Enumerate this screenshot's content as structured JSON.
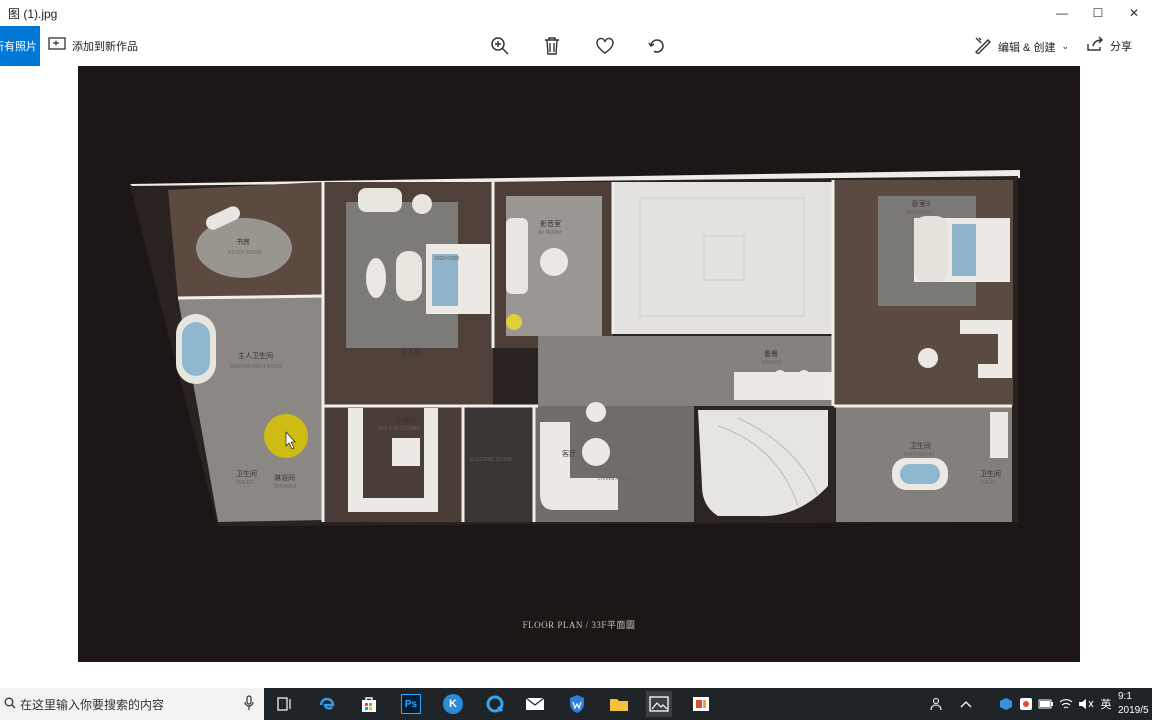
{
  "window": {
    "title": "图 (1).jpg",
    "controls": [
      "—",
      "☐",
      "✕"
    ]
  },
  "toolbar": {
    "all_photos_label": "所有照片",
    "add_to_creation_label": "添加到新作品",
    "zoom_icon": "zoom-in-icon",
    "delete_icon": "trash-icon",
    "favorite_icon": "heart-icon",
    "rotate_icon": "rotate-icon",
    "edit_create_label": "编辑 & 创建",
    "share_label": "分享"
  },
  "image": {
    "caption": "FLOOR PLAN / 33F平面圖",
    "rooms": {
      "study": "书房",
      "study_en": "STUDY ROOM",
      "master_bath": "主人卫生间",
      "master_bath_en": "MASTER BATH ROOM",
      "master_bed": "主人房",
      "av_room": "影音室",
      "av_room_en": "AV ROOM",
      "bedroom3": "卧室3",
      "bedroom3_en": "BEDROOM",
      "bed_size": "1800×2000",
      "pantry": "备餐",
      "pantry_en": "PANTRY",
      "bathroom": "卫生间",
      "bathroom_en": "BATH ROOM",
      "living": "客厅",
      "living_en": "LIVING AREA",
      "electric": "机电房",
      "electric_en": "ELECTRIC ROOM",
      "toilet": "卫生间",
      "toilet_en": "TOILET",
      "shower": "淋浴间",
      "shower_en": "SHOWER",
      "closet": "衣帽间",
      "closet_en": "WALK-IN CLOSET",
      "toilet2": "卫生间",
      "toilet2_en": "TOILET"
    }
  },
  "taskbar": {
    "search_placeholder": "在这里输入你要搜索的内容",
    "apps": [
      "task-view-icon",
      "edge-icon",
      "store-icon",
      "photoshop-icon",
      "k-app-icon",
      "q-app-icon",
      "mail-icon",
      "shield-app-icon",
      "file-explorer-icon",
      "photos-app-icon",
      "office-app-icon"
    ],
    "ps_label": "Ps",
    "ime_label": "英",
    "clock_time": "9:1",
    "clock_date": "2019/5"
  },
  "colors": {
    "accent": "#0078d7",
    "photo_bg": "#1d1617",
    "wood_floor": "#5a4a42",
    "grey_floor": "#8c8a88",
    "wall": "#f1efec",
    "cursor_highlight": "#d9c400"
  }
}
